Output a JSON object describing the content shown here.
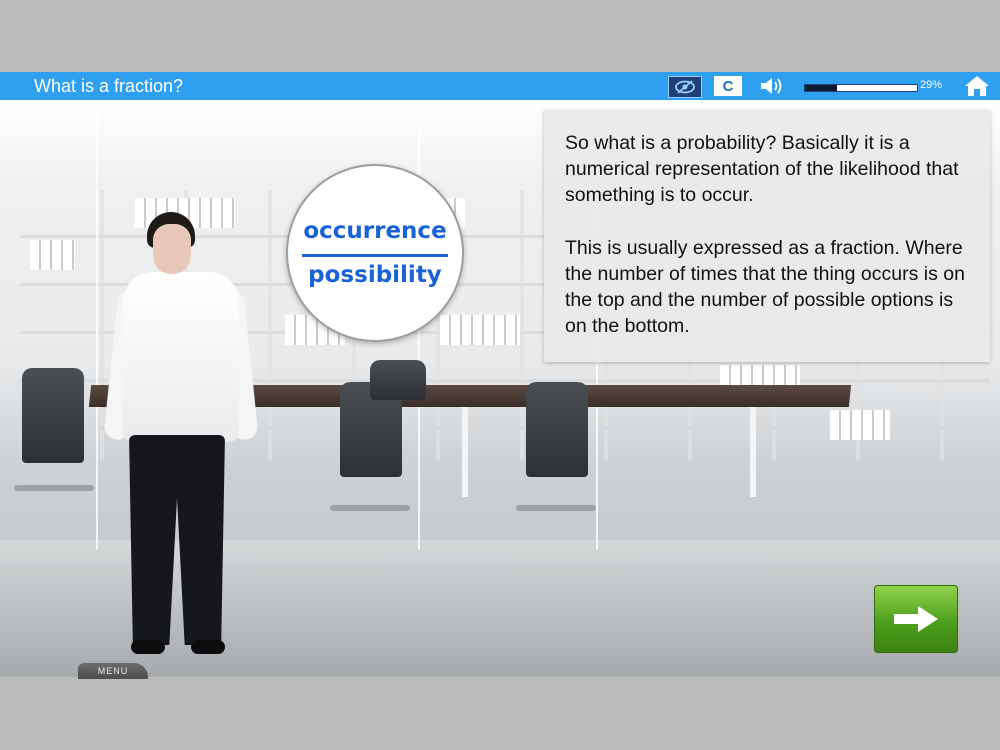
{
  "header": {
    "title": "What is a fraction?",
    "eye_icon": "eye-slash-icon",
    "replay_label": "C",
    "audio_icon": "speaker-icon",
    "progress_value": 0.29,
    "progress_text": "29%",
    "home_icon": "home-icon"
  },
  "bubble": {
    "numerator": "occurrence",
    "denominator": "possibility"
  },
  "panel": {
    "paragraph1": "So what is a probability?  Basically it is a numerical representation of the likelihood that something is to occur.",
    "paragraph2": "This is usually expressed as a fraction. Where the number of times that the thing occurs is on the top and the number of possible options is on the bottom."
  },
  "navigation": {
    "next_icon": "arrow-right-icon",
    "menu_label": "MENU"
  },
  "colors": {
    "header_bar": "#2f9ff0",
    "fraction_text": "#1a63d6",
    "next_button": "#5aa820"
  }
}
